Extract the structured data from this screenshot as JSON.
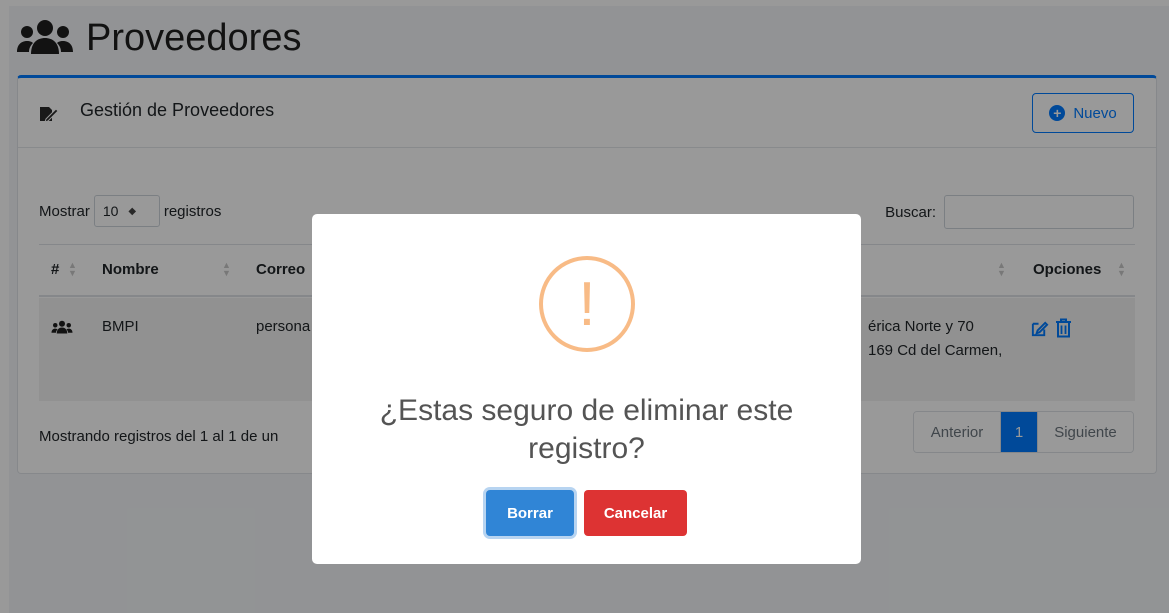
{
  "page": {
    "title": "Proveedores",
    "title_icon": "users-icon"
  },
  "card": {
    "header_title": "Gestión de Proveedores",
    "header_icon": "edit-file-icon",
    "new_button": {
      "label": "Nuevo",
      "icon": "plus-circle-icon"
    }
  },
  "table_controls": {
    "show_label": "Mostrar",
    "length_value": "10",
    "records_label": "registros",
    "search_label": "Buscar:",
    "search_value": ""
  },
  "table": {
    "columns": [
      "#",
      "Nombre",
      "Correo",
      "Opciones"
    ],
    "rows": [
      {
        "icon": "users-icon",
        "nombre": "BMPI",
        "correo": "persona",
        "direccion_line1": "érica Norte y 70",
        "direccion_line2": "169 Cd del Carmen,",
        "actions": [
          "edit-icon",
          "trash-icon"
        ]
      }
    ]
  },
  "footer": {
    "info": "Mostrando registros del 1 al 1 de un",
    "pagination": {
      "prev": "Anterior",
      "current": "1",
      "next": "Siguiente"
    }
  },
  "modal": {
    "icon": "warning-icon",
    "icon_glyph": "!",
    "title_line1": "¿Estas seguro de eliminar este",
    "title_line2": "registro?",
    "confirm_label": "Borrar",
    "cancel_label": "Cancelar"
  },
  "colors": {
    "primary": "#007bff",
    "confirm": "#3085d6",
    "cancel": "#dd3333",
    "warning": "#f8bb86"
  }
}
